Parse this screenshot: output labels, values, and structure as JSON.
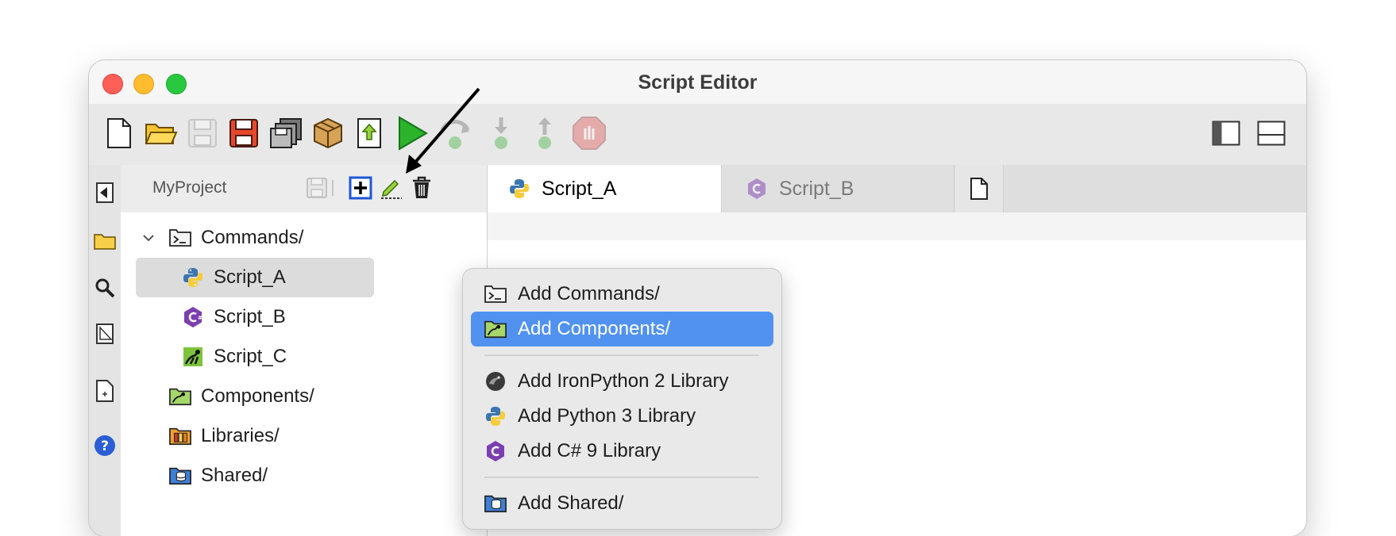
{
  "window": {
    "title": "Script Editor"
  },
  "toolbar": {
    "buttons": [
      "new-file",
      "open-folder",
      "save-disabled",
      "save",
      "save-all",
      "package",
      "publish",
      "run",
      "step-over-disabled",
      "step-into-disabled",
      "step-out-disabled",
      "stop-disabled"
    ],
    "right_buttons": [
      "layout-sidebar",
      "layout-split"
    ]
  },
  "sidebar_strip": {
    "icons": [
      "collapse-icon",
      "folder-icon",
      "search-icon",
      "ruler-icon",
      "document-icon",
      "help-icon"
    ]
  },
  "project": {
    "name": "MyProject",
    "tree": [
      {
        "label": "Commands/",
        "icon": "terminal-folder-icon",
        "expanded": true
      },
      {
        "label": "Script_A",
        "icon": "python-icon",
        "selected": true
      },
      {
        "label": "Script_B",
        "icon": "csharp-icon"
      },
      {
        "label": "Script_C",
        "icon": "grasshopper-icon"
      },
      {
        "label": "Components/",
        "icon": "components-folder-icon"
      },
      {
        "label": "Libraries/",
        "icon": "libraries-folder-icon"
      },
      {
        "label": "Shared/",
        "icon": "shared-folder-icon"
      }
    ]
  },
  "tabs": [
    {
      "label": "Script_A",
      "icon": "python-icon",
      "active": true
    },
    {
      "label": "Script_B",
      "icon": "csharp-icon",
      "active": false
    }
  ],
  "menu": {
    "items": [
      {
        "label": "Add Commands/",
        "icon": "terminal-icon"
      },
      {
        "label": "Add Components/",
        "icon": "grasshopper-icon",
        "highlighted": true
      },
      {
        "label": "Add IronPython 2 Library",
        "icon": "ironpython-icon"
      },
      {
        "label": "Add Python 3 Library",
        "icon": "python-icon"
      },
      {
        "label": "Add C# 9 Library",
        "icon": "csharp-icon"
      },
      {
        "label": "Add Shared/",
        "icon": "shared-icon"
      }
    ]
  },
  "colors": {
    "highlight": "#5192f0",
    "run_green": "#2bb32b",
    "csharp_purple": "#7b3fb0"
  }
}
